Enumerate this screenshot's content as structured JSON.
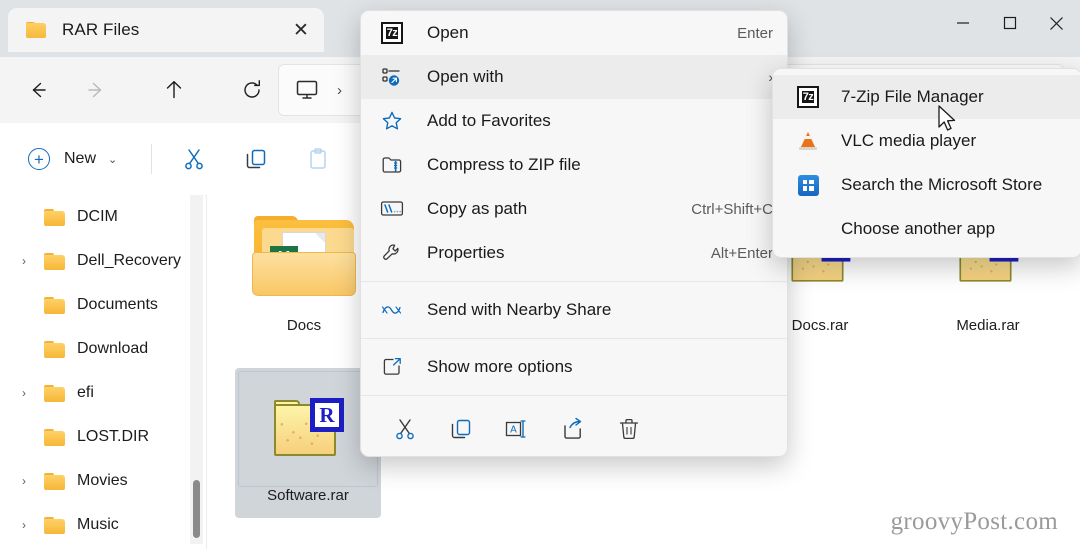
{
  "window": {
    "tab_title": "RAR Files",
    "tab_close_glyph": "✕",
    "controls": {
      "minimize": "minimize-button",
      "maximize": "maximize-button",
      "close": "close-button"
    }
  },
  "navbar": {
    "back": "Back",
    "forward": "Forward",
    "up": "Up",
    "refresh": "Refresh",
    "address_chevron": "›"
  },
  "toolbar": {
    "new_label": "New",
    "new_chevron": "⌄",
    "cut": "Cut",
    "copy": "Copy",
    "paste": "Paste"
  },
  "sidebar": {
    "items": [
      {
        "label": "DCIM",
        "expandable": false
      },
      {
        "label": "Dell_Recovery",
        "expandable": true
      },
      {
        "label": "Documents",
        "expandable": false
      },
      {
        "label": "Download",
        "expandable": false
      },
      {
        "label": "efi",
        "expandable": true
      },
      {
        "label": "LOST.DIR",
        "expandable": false
      },
      {
        "label": "Movies",
        "expandable": true
      },
      {
        "label": "Music",
        "expandable": true
      }
    ],
    "chevron_glyph": "›"
  },
  "content": {
    "files": [
      {
        "name": "Docs",
        "kind": "folder-excel",
        "selected": false
      },
      {
        "name": "Software.rar",
        "kind": "rar",
        "selected": true
      },
      {
        "name": "Docs.rar",
        "kind": "rar",
        "selected": false
      },
      {
        "name": "Media.rar",
        "kind": "rar",
        "selected": false
      }
    ]
  },
  "context_menu": {
    "items": [
      {
        "label": "Open",
        "accel": "Enter",
        "icon": "sevenzip-icon",
        "highlighted": false,
        "submenu": false
      },
      {
        "label": "Open with",
        "accel": "",
        "icon": "open-with-icon",
        "highlighted": true,
        "submenu": true,
        "submenu_glyph": "›"
      },
      {
        "label": "Add to Favorites",
        "accel": "",
        "icon": "star-icon",
        "highlighted": false,
        "submenu": false
      },
      {
        "label": "Compress to ZIP file",
        "accel": "",
        "icon": "zip-folder-icon",
        "highlighted": false,
        "submenu": false
      },
      {
        "label": "Copy as path",
        "accel": "Ctrl+Shift+C",
        "icon": "copy-path-icon",
        "highlighted": false,
        "submenu": false
      },
      {
        "label": "Properties",
        "accel": "Alt+Enter",
        "icon": "wrench-icon",
        "highlighted": false,
        "submenu": false
      },
      {
        "label": "Send with Nearby Share",
        "accel": "",
        "icon": "nearby-share-icon",
        "highlighted": false,
        "submenu": false
      },
      {
        "label": "Show more options",
        "accel": "",
        "icon": "show-more-icon",
        "highlighted": false,
        "submenu": false
      }
    ],
    "action_row": [
      "cut-icon",
      "copy-icon",
      "rename-icon",
      "share-icon",
      "delete-icon"
    ]
  },
  "submenu": {
    "items": [
      {
        "label": "7-Zip File Manager",
        "icon": "sevenzip-icon",
        "highlighted": true
      },
      {
        "label": "VLC media player",
        "icon": "vlc-icon",
        "highlighted": false
      },
      {
        "label": "Search the Microsoft Store",
        "icon": "microsoft-store-icon",
        "highlighted": false
      },
      {
        "label": "Choose another app",
        "icon": "",
        "highlighted": false
      }
    ]
  },
  "watermark": {
    "text": "groovyPost.com"
  },
  "colors": {
    "accent": "#0f6cbd",
    "titlebar": "#dfe3e6",
    "menu_bg": "#f7f7f7",
    "selection": "#d0d5da",
    "folder_yellow": "#f6b737",
    "rar_blue": "#1d1fc4"
  }
}
